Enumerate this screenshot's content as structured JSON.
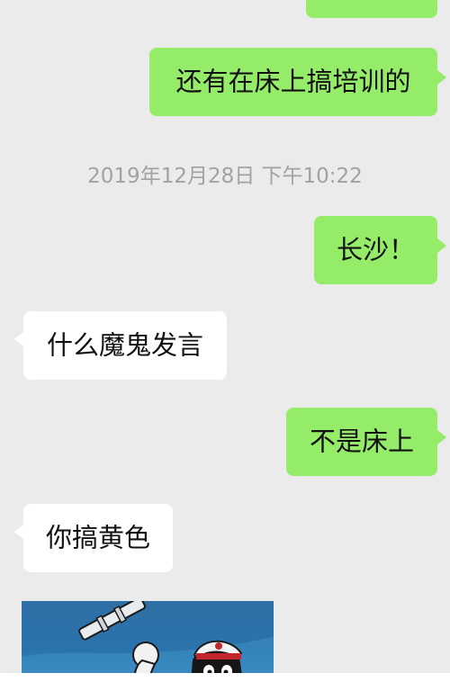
{
  "messages": [
    {
      "id": "prev",
      "direction": "outgoing",
      "text": ""
    },
    {
      "id": "training",
      "direction": "outgoing",
      "text": "还有在床上搞培训的"
    },
    {
      "id": "changsha",
      "direction": "outgoing",
      "text": "长沙！"
    },
    {
      "id": "nonsense",
      "direction": "incoming",
      "text": "什么魔鬼发言"
    },
    {
      "id": "notbed",
      "direction": "outgoing",
      "text": "不是床上"
    },
    {
      "id": "yellow",
      "direction": "incoming",
      "text": "你搞黄色"
    }
  ],
  "timestamp": "2019年12月28日 下午10:22",
  "image_message": {
    "icon": "cartoon-image"
  },
  "colors": {
    "background": "#ebebeb",
    "outgoing_bubble": "#95ec69",
    "incoming_bubble": "#ffffff",
    "timestamp": "#a2a2a2"
  }
}
